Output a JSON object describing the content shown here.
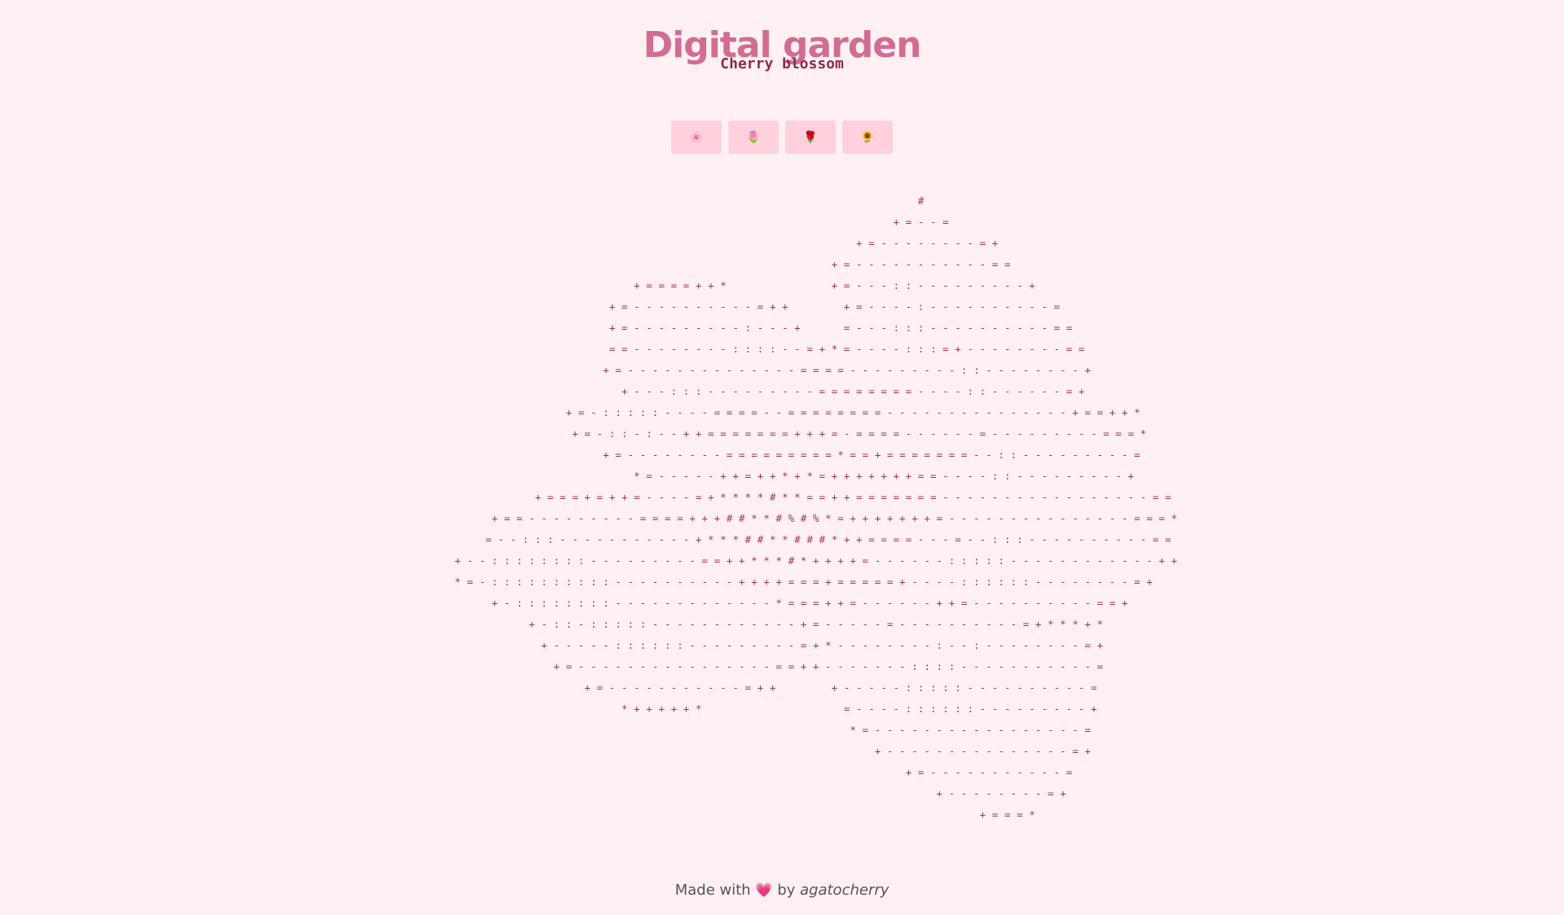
{
  "header": {
    "title": "Digital garden",
    "subtitle": "Cherry blossom"
  },
  "flower_buttons": [
    {
      "icon": "cherry-blossom-icon",
      "glyph": "🌸"
    },
    {
      "icon": "tulip-icon",
      "glyph": "🌷"
    },
    {
      "icon": "rose-icon",
      "glyph": "🌹"
    },
    {
      "icon": "sunflower-icon",
      "glyph": "🌻"
    }
  ],
  "art_rows": [
    "                                                                       #                          ",
    "                                                                   + = - - =                      ",
    "                                                             + = - - - - - - - - = +              ",
    "                                                         + = - - - - - - - - - - - = =            ",
    "                         + = = = = + + *                 + = - - - : : - - - - - - - - - +        ",
    "                     + = - - - - - - - - - - = + +         + = - - - - : - - - - - - - - - - =    ",
    "                     + = - - - - - - - - - : - - - +       = - - - : : : - - - - - - - - - - = =  ",
    "                     = = - - - - - - - - : : : : - - = + * = - - - - : : : = + - - - - - - - - = =",
    "                     + = - - - - - - - - - - - - - - = = = = - - - - - - - - - : : - - - - - - - - +",
    "                       + - - - : : : - - - - - - - - - = = = = = = = = - - - - : : - - - - - - = +",
    "                       + = - : : : : : - - - - = = = = - - = = = = = = = = - - - - - - - - - - - - - - - + = = + + *",
    "                         + = - : : - : - - + + = = = = = = = + + + = - = = = = - - - - - - = - - - - - - - - - = = = *",
    "                             + = - - - - - - - - = = = = = = = = = * = = + = = = = = = = - - : : - - - - - - - - - =",
    "                                 * = - - - - - + + = + + * + * = + + + + + + + = = - - - - : : - - - - - - - - - +",
    "                       + = = = + = + + = - - - - = + * * * * # * * = = + + = = = = = = = - - - - - - - - - - - - - - - - - = =",
    "                 + = = - - - - - - - - - = = = = + + + # # * * # % # % * = + + + + + + + = - - - - - - - - - - - - - - - = = = *",
    "               = - - : : : - - - - - - - - - - - + * * * # # * * # # # * + + = = = = - - - = - - : : : - - - - - - - - - - = =",
    "           + - - : : : : : : : : - - - - - - - - - = = + + * * * # * + + + + = - - - - - - : : : : : - - - - - - - - - - - - + +",
    "       * = - : : : : : : : : : : - - - - - - - - - - + + + + = = = + = = = = = + - - - - : : : : : : - - - - - - - - = +",
    "         + - : : : : : : : : - - - - - - - - - - - - - * = = = + + = - - - - - - + + = - - - - - - - - - - = = +",
    "           + - : : - : : : : : - - - - - - - - - - - - + = - - - - - = - - - - - - - - - - = + * * * + *",
    "             + - - - - - : : : : : : - - - - - - - - - = + * - - - - - - - - : - - : - - - - - - - - = +",
    "               + = - - - - - - - - - - - - - - - - = = + + - - - - - - - : : : : - - - - - - - - - - - =",
    "                   + = - - - - - - - - - - - = + +         + - - - - - : : : : : - - - - - - - - - - =",
    "                         * + + + + + *                       = - - - - : : : : : : - - - - - - - - - +",
    "                                                             * = - - - - - - - - - - - - - - - - - =",
    "                                                                 + - - - - - - - - - - - - - - - = +",
    "                                                                   + = - - - - - - - - - - - =",
    "                                                                       + - - - - - - - - = +",
    "                                                                         + = = = *"
  ],
  "footer": {
    "prefix": "Made with",
    "heart": "💗",
    "by": "by",
    "author": "agatocherry"
  },
  "colors": {
    "background": "#fff0f3",
    "title": "#d16d93",
    "subtitle": "#8a2a4a",
    "button": "#ffd1dc",
    "art": "#9c3558"
  }
}
